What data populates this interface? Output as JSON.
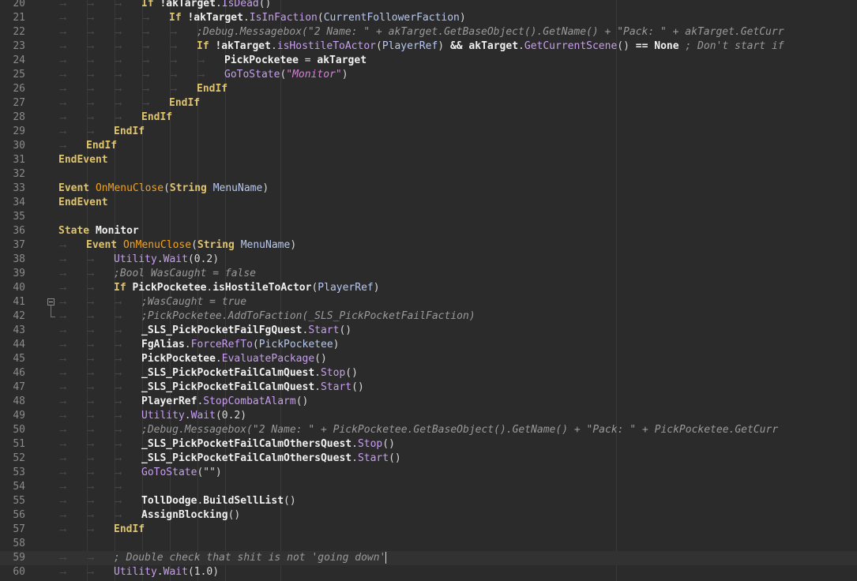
{
  "editor": {
    "colors": {
      "background": "#2b2b2b",
      "current_line": "#323232",
      "keyword": "#e0c46c",
      "function": "#c89ef0",
      "event": "#f5a11a",
      "string": "#e07be0",
      "comment": "#9a9a9a"
    },
    "current_line_number": "59",
    "lines": [
      {
        "n": "20",
        "indent": 3,
        "tokens": [
          [
            "kw",
            "If"
          ],
          [
            "pl",
            " "
          ],
          [
            "id",
            "!akTarget"
          ],
          [
            "pl",
            "."
          ],
          [
            "fn",
            "IsDead"
          ],
          [
            "pl",
            "()"
          ]
        ]
      },
      {
        "n": "21",
        "indent": 4,
        "tokens": [
          [
            "kw",
            "If"
          ],
          [
            "pl",
            " "
          ],
          [
            "id",
            "!akTarget"
          ],
          [
            "pl",
            "."
          ],
          [
            "fn",
            "IsInFaction"
          ],
          [
            "pl",
            "("
          ],
          [
            "ty",
            "CurrentFollowerFaction"
          ],
          [
            "pl",
            ")"
          ]
        ]
      },
      {
        "n": "22",
        "indent": 5,
        "tokens": [
          [
            "cm",
            ";Debug.Messagebox(\"2 Name: \" + akTarget.GetBaseObject().GetName() + \"Pack: \" + akTarget.GetCurr"
          ]
        ]
      },
      {
        "n": "23",
        "indent": 5,
        "tokens": [
          [
            "kw",
            "If"
          ],
          [
            "pl",
            " "
          ],
          [
            "id",
            "!akTarget"
          ],
          [
            "pl",
            "."
          ],
          [
            "fn",
            "isHostileToActor"
          ],
          [
            "pl",
            "("
          ],
          [
            "ty",
            "PlayerRef"
          ],
          [
            "pl",
            ")"
          ],
          [
            "pl",
            " "
          ],
          [
            "id",
            "&&"
          ],
          [
            "pl",
            " "
          ],
          [
            "id",
            "akTarget"
          ],
          [
            "pl",
            "."
          ],
          [
            "fn",
            "GetCurrentScene"
          ],
          [
            "pl",
            "()"
          ],
          [
            "pl",
            " "
          ],
          [
            "id",
            "=="
          ],
          [
            "pl",
            " "
          ],
          [
            "id",
            "None"
          ],
          [
            "pl",
            " "
          ],
          [
            "cm",
            "; Don't start if"
          ]
        ]
      },
      {
        "n": "24",
        "indent": 6,
        "tokens": [
          [
            "id",
            "PickPocketee"
          ],
          [
            "pl",
            " = "
          ],
          [
            "id",
            "akTarget"
          ]
        ]
      },
      {
        "n": "25",
        "indent": 6,
        "tokens": [
          [
            "fn",
            "GoToState"
          ],
          [
            "pl",
            "("
          ],
          [
            "str",
            "\"Monitor\""
          ],
          [
            "pl",
            ")"
          ]
        ]
      },
      {
        "n": "26",
        "indent": 5,
        "tokens": [
          [
            "kw",
            "EndIf"
          ]
        ]
      },
      {
        "n": "27",
        "indent": 4,
        "tokens": [
          [
            "kw",
            "EndIf"
          ]
        ]
      },
      {
        "n": "28",
        "indent": 3,
        "tokens": [
          [
            "kw",
            "EndIf"
          ]
        ]
      },
      {
        "n": "29",
        "indent": 2,
        "tokens": [
          [
            "kw",
            "EndIf"
          ]
        ]
      },
      {
        "n": "30",
        "indent": 1,
        "tokens": [
          [
            "kw",
            "EndIf"
          ]
        ]
      },
      {
        "n": "31",
        "indent": 0,
        "tokens": [
          [
            "kw",
            "EndEvent"
          ]
        ]
      },
      {
        "n": "32",
        "indent": 0,
        "tokens": []
      },
      {
        "n": "33",
        "indent": 0,
        "tokens": [
          [
            "kw",
            "Event"
          ],
          [
            "pl",
            " "
          ],
          [
            "ev",
            "OnMenuClose"
          ],
          [
            "pl",
            "("
          ],
          [
            "kw",
            "String"
          ],
          [
            "pl",
            " "
          ],
          [
            "ty",
            "MenuName"
          ],
          [
            "pl",
            ")"
          ]
        ]
      },
      {
        "n": "34",
        "indent": 0,
        "tokens": [
          [
            "kw",
            "EndEvent"
          ]
        ]
      },
      {
        "n": "35",
        "indent": 0,
        "tokens": []
      },
      {
        "n": "36",
        "indent": 0,
        "tokens": [
          [
            "kw",
            "State"
          ],
          [
            "pl",
            " "
          ],
          [
            "id",
            "Monitor"
          ]
        ]
      },
      {
        "n": "37",
        "indent": 1,
        "tokens": [
          [
            "kw",
            "Event"
          ],
          [
            "pl",
            " "
          ],
          [
            "ev",
            "OnMenuClose"
          ],
          [
            "pl",
            "("
          ],
          [
            "kw",
            "String"
          ],
          [
            "pl",
            " "
          ],
          [
            "ty",
            "MenuName"
          ],
          [
            "pl",
            ")"
          ]
        ]
      },
      {
        "n": "38",
        "indent": 2,
        "tokens": [
          [
            "fn",
            "Utility"
          ],
          [
            "pl",
            "."
          ],
          [
            "fn",
            "Wait"
          ],
          [
            "pl",
            "(0.2)"
          ]
        ]
      },
      {
        "n": "39",
        "indent": 2,
        "tokens": [
          [
            "cm",
            ";Bool WasCaught = false"
          ]
        ]
      },
      {
        "n": "40",
        "indent": 2,
        "tokens": [
          [
            "kw",
            "If"
          ],
          [
            "pl",
            " "
          ],
          [
            "id",
            "PickPocketee"
          ],
          [
            "pl",
            "."
          ],
          [
            "id",
            "isHostileToActor"
          ],
          [
            "pl",
            "("
          ],
          [
            "ty",
            "PlayerRef"
          ],
          [
            "pl",
            ")"
          ]
        ]
      },
      {
        "n": "41",
        "indent": 3,
        "tokens": [
          [
            "cm",
            ";WasCaught = true"
          ]
        ]
      },
      {
        "n": "42",
        "indent": 3,
        "tokens": [
          [
            "cm",
            ";PickPocketee.AddToFaction(_SLS_PickPocketFailFaction)"
          ]
        ]
      },
      {
        "n": "43",
        "indent": 3,
        "tokens": [
          [
            "id",
            "_SLS_PickPocketFailFgQuest"
          ],
          [
            "pl",
            "."
          ],
          [
            "fn",
            "Start"
          ],
          [
            "pl",
            "()"
          ]
        ]
      },
      {
        "n": "44",
        "indent": 3,
        "tokens": [
          [
            "id",
            "FgAlias"
          ],
          [
            "pl",
            "."
          ],
          [
            "fn",
            "ForceRefTo"
          ],
          [
            "pl",
            "("
          ],
          [
            "ty",
            "PickPocketee"
          ],
          [
            "pl",
            ")"
          ]
        ]
      },
      {
        "n": "45",
        "indent": 3,
        "tokens": [
          [
            "id",
            "PickPocketee"
          ],
          [
            "pl",
            "."
          ],
          [
            "fn",
            "EvaluatePackage"
          ],
          [
            "pl",
            "()"
          ]
        ]
      },
      {
        "n": "46",
        "indent": 3,
        "tokens": [
          [
            "id",
            "_SLS_PickPocketFailCalmQuest"
          ],
          [
            "pl",
            "."
          ],
          [
            "fn",
            "Stop"
          ],
          [
            "pl",
            "()"
          ]
        ]
      },
      {
        "n": "47",
        "indent": 3,
        "tokens": [
          [
            "id",
            "_SLS_PickPocketFailCalmQuest"
          ],
          [
            "pl",
            "."
          ],
          [
            "fn",
            "Start"
          ],
          [
            "pl",
            "()"
          ]
        ]
      },
      {
        "n": "48",
        "indent": 3,
        "tokens": [
          [
            "id",
            "PlayerRef"
          ],
          [
            "pl",
            "."
          ],
          [
            "fn",
            "StopCombatAlarm"
          ],
          [
            "pl",
            "()"
          ]
        ]
      },
      {
        "n": "49",
        "indent": 3,
        "tokens": [
          [
            "fn",
            "Utility"
          ],
          [
            "pl",
            "."
          ],
          [
            "fn",
            "Wait"
          ],
          [
            "pl",
            "(0.2)"
          ]
        ]
      },
      {
        "n": "50",
        "indent": 3,
        "tokens": [
          [
            "cm",
            ";Debug.Messagebox(\"2 Name: \" + PickPocketee.GetBaseObject().GetName() + \"Pack: \" + PickPocketee.GetCurr"
          ]
        ]
      },
      {
        "n": "51",
        "indent": 3,
        "tokens": [
          [
            "id",
            "_SLS_PickPocketFailCalmOthersQuest"
          ],
          [
            "pl",
            "."
          ],
          [
            "fn",
            "Stop"
          ],
          [
            "pl",
            "()"
          ]
        ]
      },
      {
        "n": "52",
        "indent": 3,
        "tokens": [
          [
            "id",
            "_SLS_PickPocketFailCalmOthersQuest"
          ],
          [
            "pl",
            "."
          ],
          [
            "fn",
            "Start"
          ],
          [
            "pl",
            "()"
          ]
        ]
      },
      {
        "n": "53",
        "indent": 3,
        "tokens": [
          [
            "fn",
            "GoToState"
          ],
          [
            "pl",
            "(\"\")"
          ]
        ]
      },
      {
        "n": "54",
        "indent": 3,
        "tokens": []
      },
      {
        "n": "55",
        "indent": 3,
        "tokens": [
          [
            "id",
            "TollDodge"
          ],
          [
            "pl",
            "."
          ],
          [
            "id",
            "BuildSellList"
          ],
          [
            "pl",
            "()"
          ]
        ]
      },
      {
        "n": "56",
        "indent": 3,
        "tokens": [
          [
            "id",
            "AssignBlocking"
          ],
          [
            "pl",
            "()"
          ]
        ]
      },
      {
        "n": "57",
        "indent": 2,
        "tokens": [
          [
            "kw",
            "EndIf"
          ]
        ]
      },
      {
        "n": "58",
        "indent": 0,
        "tokens": []
      },
      {
        "n": "59",
        "indent": 2,
        "tokens": [
          [
            "cm",
            "; Double check that shit is not 'going down'"
          ]
        ]
      },
      {
        "n": "60",
        "indent": 2,
        "tokens": [
          [
            "fn",
            "Utility"
          ],
          [
            "pl",
            "."
          ],
          [
            "fn",
            "Wait"
          ],
          [
            "pl",
            "(1.0)"
          ]
        ]
      }
    ]
  }
}
